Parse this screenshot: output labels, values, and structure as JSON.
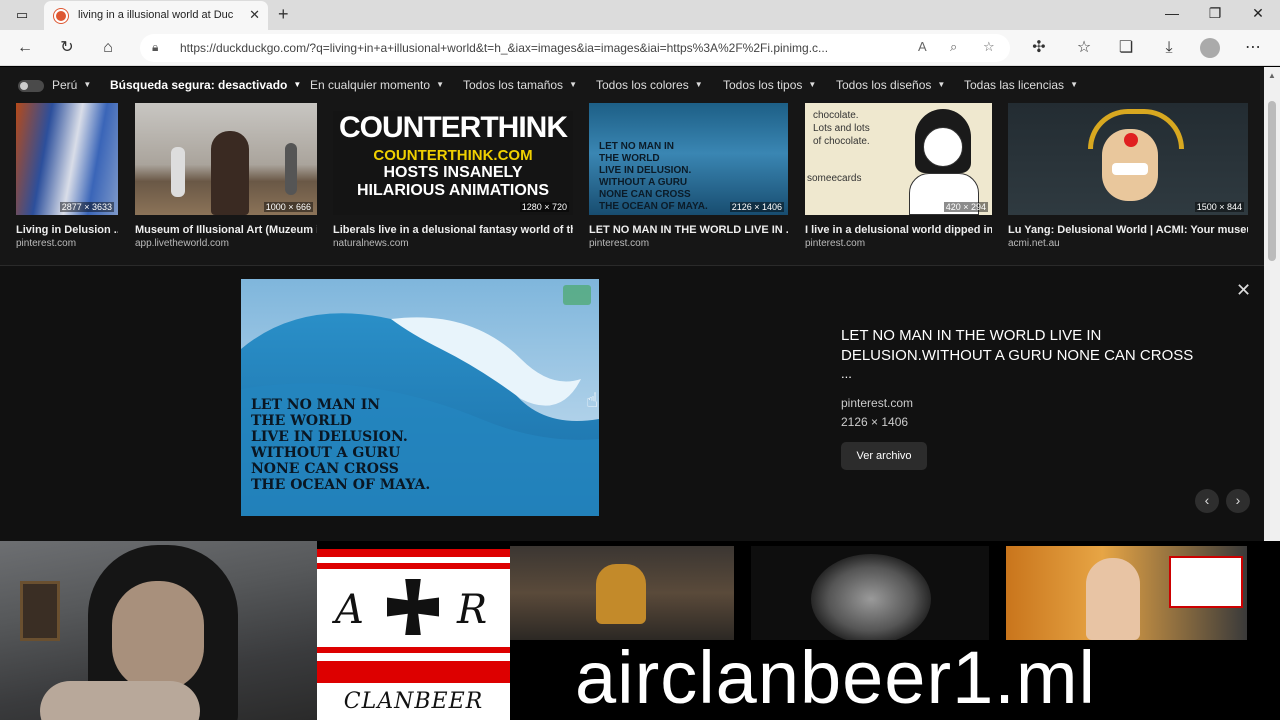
{
  "browser": {
    "tab_title": "living in a illusional world at Duc",
    "url": "https://duckduckgo.com/?q=living+in+a+illusional+world&t=h_&iax=images&ia=images&iai=https%3A%2F%2Fi.pinimg.c..."
  },
  "filters": {
    "region": "Perú",
    "safe_search": "Búsqueda segura: desactivado",
    "time": "En cualquier momento",
    "size": "Todos los tamaños",
    "color": "Todos los colores",
    "type": "Todos los tipos",
    "layout": "Todos los diseños",
    "license": "Todas las licencias"
  },
  "results": [
    {
      "title": "Living in Delusion ...",
      "source": "pinterest.com",
      "dims": "2877 × 3633"
    },
    {
      "title": "Museum of Illusional Art (Muzeum i...",
      "source": "app.livetheworld.com",
      "dims": "1000 × 666"
    },
    {
      "title": "Liberals live in a delusional fantasy world of th...",
      "source": "naturalnews.com",
      "dims": "1280 × 720",
      "image_text": {
        "l1": "COUNTERTHINK",
        "l2": "COUNTERTHINK.COM",
        "l3": "HOSTS INSANELY",
        "l4": "HILARIOUS ANIMATIONS"
      }
    },
    {
      "title": "LET NO MAN IN THE WORLD LIVE IN ...",
      "source": "pinterest.com",
      "dims": "2126 × 1406"
    },
    {
      "title": "I live in a delusional world dipped in...",
      "source": "pinterest.com",
      "dims": "420 × 294",
      "image_text": {
        "l1": "chocolate.",
        "l2": "Lots and lots",
        "l3": "of chocolate.",
        "l4": "someecards"
      }
    },
    {
      "title": "Lu Yang: Delusional World | ACMI: Your museu...",
      "source": "acmi.net.au",
      "dims": "1500 × 844"
    }
  ],
  "detail": {
    "title": "LET NO MAN IN THE WORLD LIVE IN DELUSION.WITHOUT A GURU NONE CAN CROSS",
    "ellipsis": "...",
    "source": "pinterest.com",
    "dims": "2126 × 1406",
    "button": "Ver archivo",
    "image_lines": [
      "LET NO MAN IN",
      "THE WORLD",
      "LIVE IN DELUSION.",
      "WITHOUT A GURU",
      "NONE CAN CROSS",
      "THE OCEAN OF MAYA."
    ]
  },
  "overlay": {
    "brand": "airclanbeer1.ml",
    "logo_left": "A",
    "logo_right": "R",
    "logo_bottom": "CLANBEER"
  },
  "colors": {
    "page_bg": "#161616",
    "detail_bg": "#111111",
    "ddg_orange": "#de5833"
  }
}
